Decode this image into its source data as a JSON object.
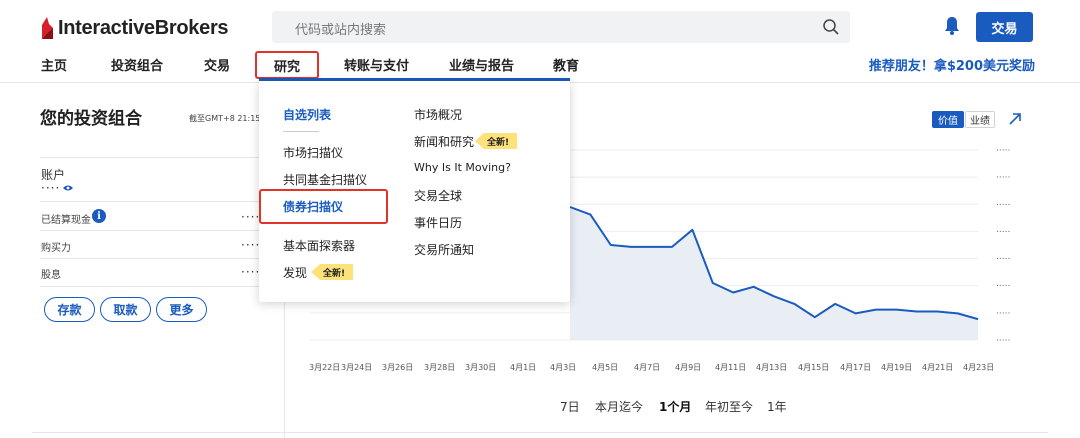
{
  "header": {
    "logo_text": "InteractiveBrokers",
    "search_placeholder": "代码或站内搜索",
    "trade_button": "交易",
    "accent": "#1a5bbf"
  },
  "nav": {
    "items": [
      "主页",
      "投资组合",
      "交易",
      "研究",
      "转账与支付",
      "业绩与报告",
      "教育"
    ],
    "active": "研究",
    "promo": "推荐朋友！拿$200美元奖励"
  },
  "portfolio": {
    "title": "您的投资组合",
    "timestamp": "截至GMT+8 21:15:13",
    "account_label": "账户",
    "masked": "····",
    "rows": [
      {
        "label": "已结算现金",
        "value": "····"
      },
      {
        "label": "购买力",
        "value": "····"
      },
      {
        "label": "股息",
        "value": "····"
      }
    ],
    "buttons": [
      "存款",
      "取款",
      "更多"
    ]
  },
  "chart": {
    "toggles": [
      "价值",
      "业绩"
    ],
    "y_tick_labels": [
      "·····",
      "·····",
      "·····",
      "·····",
      "·····",
      "·····",
      "·····",
      "·····"
    ],
    "x_ticks": [
      "3月22日",
      "3月24日",
      "3月26日",
      "3月28日",
      "3月30日",
      "4月1日",
      "4月3日",
      "4月5日",
      "4月7日",
      "4月9日",
      "4月11日",
      "4月13日",
      "4月15日",
      "4月17日",
      "4月19日",
      "4月21日",
      "4月23日"
    ],
    "ranges": [
      "7日",
      "本月迄今",
      "1个月",
      "年初至今",
      "1年"
    ],
    "active_range": "1个月"
  },
  "chart_data": {
    "type": "area",
    "x": [
      "4月3日",
      "4月4日",
      "4月5日",
      "4月6日",
      "4月7日",
      "4月8日",
      "4月9日",
      "4月10日",
      "4月11日",
      "4月12日",
      "4月13日",
      "4月14日",
      "4月15日",
      "4月16日",
      "4月17日",
      "4月18日",
      "4月19日",
      "4月20日",
      "4月21日",
      "4月22日",
      "4月23日"
    ],
    "values": [
      7.0,
      6.6,
      5.0,
      4.9,
      4.9,
      4.9,
      5.8,
      3.0,
      2.5,
      2.8,
      2.3,
      1.9,
      1.2,
      1.9,
      1.4,
      1.6,
      1.6,
      1.5,
      1.5,
      1.4,
      1.1
    ],
    "ylim": [
      0,
      10
    ],
    "y_labels_masked": true,
    "line_color": "#1a5bbf",
    "fill_color": "#e9eef5"
  },
  "dropdown": {
    "col1": [
      "自选列表",
      "市场扫描仪",
      "共同基金扫描仪",
      "债券扫描仪",
      "基本面探索器",
      "发现"
    ],
    "col2": [
      "市场概况",
      "新闻和研究",
      "Why Is It Moving?",
      "交易全球",
      "事件日历",
      "交易所通知"
    ],
    "badge": "全新!"
  }
}
